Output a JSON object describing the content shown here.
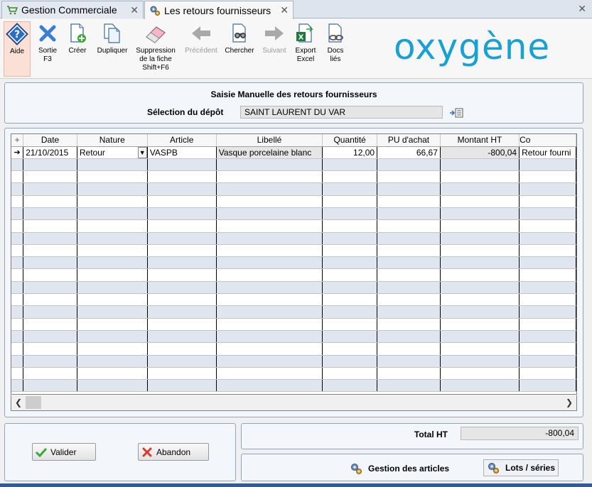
{
  "tabs": [
    {
      "label": "Gestion Commerciale",
      "active": false
    },
    {
      "label": "Les retours fournisseurs",
      "active": true
    }
  ],
  "toolbar": {
    "aide": "Aide",
    "sortie": "Sortie",
    "sortie_key": "F3",
    "creer": "Créer",
    "dupliquer": "Dupliquer",
    "suppression_1": "Suppression",
    "suppression_2": "de la fiche",
    "suppression_3": "Shift+F6",
    "precedent": "Précédent",
    "chercher": "Chercher",
    "suivant": "Suivant",
    "export_1": "Export",
    "export_2": "Excel",
    "docs_1": "Docs",
    "docs_2": "liés"
  },
  "logo": {
    "text": "oxygène",
    "color": "#1aa1d4"
  },
  "header": {
    "title": "Saisie Manuelle des retours fournisseurs",
    "depot_label": "Sélection du dépôt",
    "depot_value": "SAINT LAURENT DU VAR"
  },
  "grid": {
    "columns": [
      "Date",
      "Nature",
      "Article",
      "Libellé",
      "Quantité",
      "PU d'achat",
      "Montant HT",
      "Co"
    ],
    "rows": [
      {
        "date": "21/10/2015",
        "nature": "Retour",
        "article": "VASPB",
        "libelle": "Vasque porcelaine blanc",
        "quantite": "12,00",
        "pu": "66,67",
        "montant": "-800,04",
        "commentaire": "Retour fourni"
      }
    ]
  },
  "buttons": {
    "valider": "Valider",
    "abandon": "Abandon"
  },
  "totals": {
    "label": "Total HT",
    "value": "-800,04"
  },
  "links": {
    "gestion_articles": "Gestion des articles",
    "lots_series": "Lots / séries"
  },
  "colors": {
    "accent": "#1aa1d4",
    "panel_border": "#8ea6c2",
    "alt_row": "#dfe6f0"
  }
}
